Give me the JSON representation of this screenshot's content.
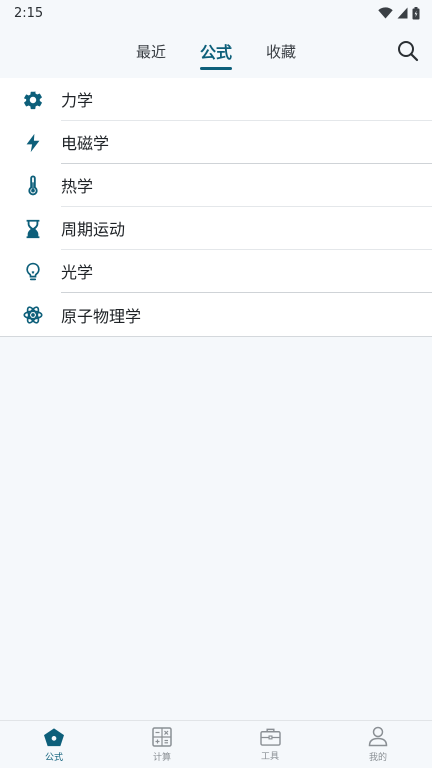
{
  "status_bar": {
    "time": "2:15",
    "icons": [
      "wifi-icon",
      "cellular-icon",
      "battery-icon"
    ]
  },
  "top_tabs": [
    {
      "label": "最近",
      "active": false
    },
    {
      "label": "公式",
      "active": true
    },
    {
      "label": "收藏",
      "active": false
    }
  ],
  "search": {
    "icon": "search-icon"
  },
  "categories": [
    {
      "label": "力学",
      "icon": "gear-icon"
    },
    {
      "label": "电磁学",
      "icon": "lightning-icon"
    },
    {
      "label": "热学",
      "icon": "thermometer-icon"
    },
    {
      "label": "周期运动",
      "icon": "hourglass-icon"
    },
    {
      "label": "光学",
      "icon": "lightbulb-icon"
    },
    {
      "label": "原子物理学",
      "icon": "atom-icon"
    }
  ],
  "bottom_nav": [
    {
      "label": "公式",
      "icon": "formula-home-icon",
      "active": true
    },
    {
      "label": "计算",
      "icon": "calculator-icon",
      "active": false
    },
    {
      "label": "工具",
      "icon": "toolbox-icon",
      "active": false
    },
    {
      "label": "我的",
      "icon": "user-icon",
      "active": false
    }
  ],
  "colors": {
    "accent": "#0d5f7a",
    "background": "#f5f8fb",
    "inactive_nav": "#8a8f94"
  }
}
